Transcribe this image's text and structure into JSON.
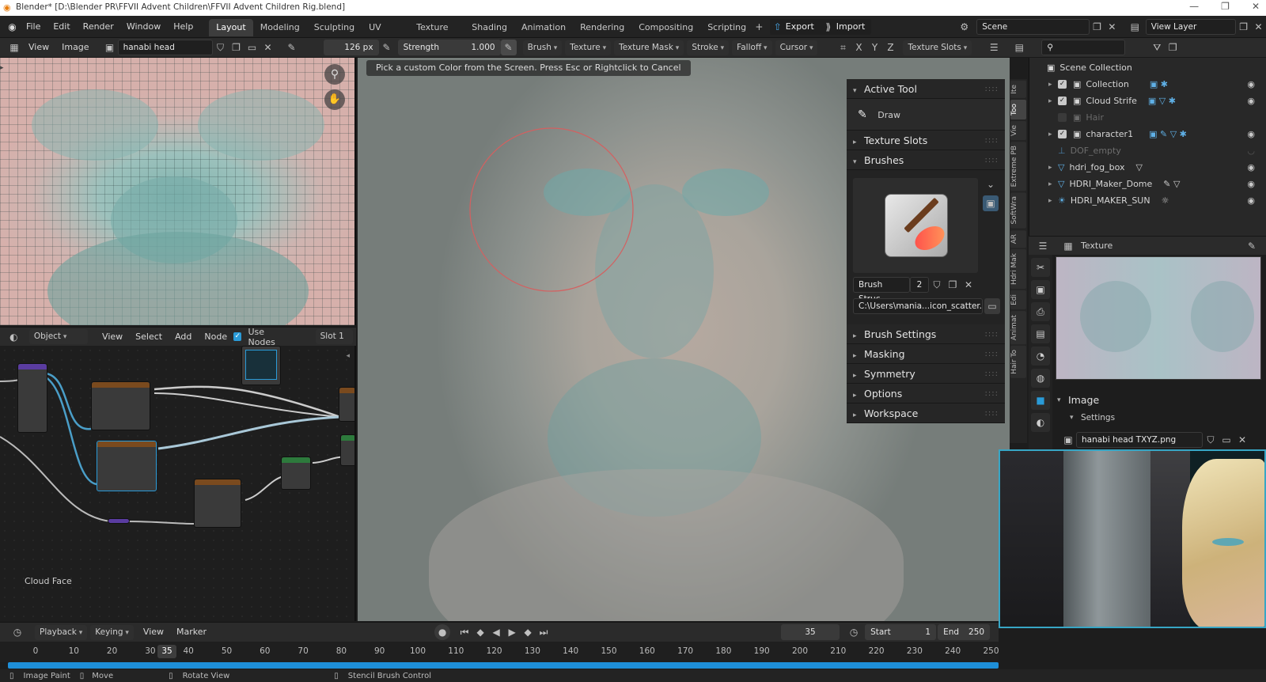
{
  "titlebar": {
    "title": "Blender* [D:\\Blender PR\\FFVII Advent Children\\FFVII Advent Children Rig.blend]"
  },
  "menu": {
    "items": [
      "File",
      "Edit",
      "Render",
      "Window",
      "Help"
    ],
    "workspaces": [
      "Layout",
      "Modeling",
      "Sculpting",
      "UV Editing",
      "Texture Paint",
      "Shading",
      "Animation",
      "Rendering",
      "Compositing",
      "Scripting"
    ],
    "active_workspace": "Layout",
    "export_label": "Export",
    "import_label": "Import",
    "scene": "Scene",
    "view_layer": "View Layer"
  },
  "toolbar": {
    "view": "View",
    "image": "Image",
    "image_name": "hanabi head TXYZ.png",
    "radius": "126 px",
    "strength_label": "Strength",
    "strength_value": "1.000",
    "dropdowns": [
      "Brush",
      "Texture",
      "Texture Mask",
      "Stroke",
      "Falloff",
      "Cursor"
    ],
    "axes": [
      "X",
      "Y",
      "Z"
    ],
    "texture_slots": "Texture Slots"
  },
  "hint": "Pick a custom Color from the Screen. Press Esc or Rightclick to Cancel",
  "node_editor": {
    "mode": "Object",
    "menu": [
      "View",
      "Select",
      "Add",
      "Node"
    ],
    "use_nodes_label": "Use Nodes",
    "slot": "Slot 1",
    "material_label": "Cloud Face"
  },
  "npanel": {
    "active_tool": "Active Tool",
    "tool_name": "Draw",
    "texture_slots": "Texture Slots",
    "brushes": "Brushes",
    "brush_name": "Brush Struc...",
    "brush_users": "2",
    "brush_path": "C:\\Users\\mania...icon_scatter.png",
    "sections": [
      "Brush Settings",
      "Masking",
      "Symmetry",
      "Options",
      "Workspace"
    ]
  },
  "vtabs": [
    "Ite",
    "Too",
    "Vie",
    "Extreme PB",
    "SoftWra",
    "AR",
    "Hdri Mak",
    "Edi",
    "Animat",
    "Hair To"
  ],
  "outliner": {
    "root": "Scene Collection",
    "rows": [
      {
        "name": "Collection",
        "checked": true,
        "eye": true
      },
      {
        "name": "Cloud Strife",
        "checked": true,
        "eye": true
      },
      {
        "name": "Hair",
        "checked": false,
        "eye": false
      },
      {
        "name": "character1",
        "checked": true,
        "eye": true
      },
      {
        "name": "DOF_empty",
        "checked": null,
        "eye": false
      },
      {
        "name": "hdri_fog_box",
        "checked": null,
        "eye": true
      },
      {
        "name": "HDRI_Maker_Dome",
        "checked": null,
        "eye": true
      },
      {
        "name": "HDRI_MAKER_SUN",
        "checked": null,
        "eye": true
      }
    ]
  },
  "properties": {
    "header": "Texture",
    "image_section": "Image",
    "settings": "Settings",
    "image_name": "hanabi head TXYZ.png"
  },
  "timeline": {
    "menu": [
      "Playback",
      "Keying",
      "View",
      "Marker"
    ],
    "current_frame": "35",
    "start_label": "Start",
    "start": "1",
    "end_label": "End",
    "end": "250",
    "ticks": [
      "0",
      "10",
      "20",
      "30",
      "40",
      "50",
      "60",
      "70",
      "80",
      "90",
      "100",
      "110",
      "120",
      "130",
      "140",
      "150",
      "160",
      "170",
      "180",
      "190",
      "200",
      "210",
      "220",
      "230",
      "240",
      "250"
    ],
    "playhead_label": "35"
  },
  "status": {
    "items": [
      "Image Paint",
      "Move",
      "Rotate View",
      "Stencil Brush Control"
    ]
  },
  "colors": {
    "accent": "#1e8fd8",
    "selected": "#2a9bd8",
    "brush_ring": "#d46060"
  }
}
